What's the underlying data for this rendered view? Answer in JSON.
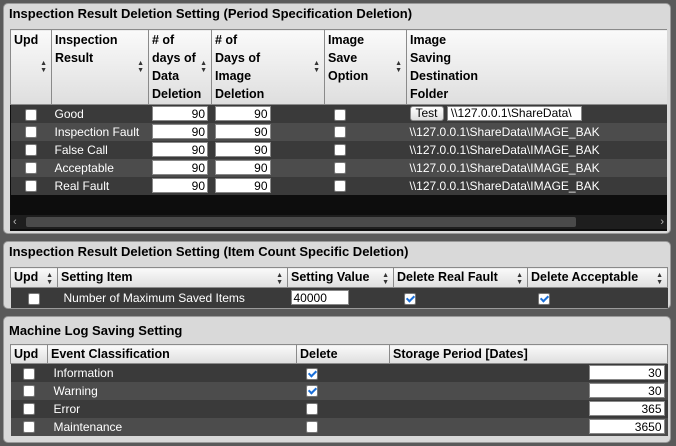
{
  "section1": {
    "title": "Inspection Result Deletion Setting (Period Specification Deletion)",
    "headers": [
      "Upd",
      "Inspection\nResult",
      "# of\ndays of\nData\nDeletion",
      "# of\nDays of\nImage\nDeletion",
      "Image\nSave\nOption",
      "Image\nSaving\nDestination\nFolder"
    ],
    "rows": [
      {
        "upd": false,
        "result": "Good",
        "data_days": "90",
        "image_days": "90",
        "save_option": false,
        "folder": "\\\\127.0.0.1\\ShareData\\",
        "test_label": "Test"
      },
      {
        "upd": false,
        "result": "Inspection Fault",
        "data_days": "90",
        "image_days": "90",
        "save_option": false,
        "folder": "\\\\127.0.0.1\\ShareData\\IMAGE_BAK"
      },
      {
        "upd": false,
        "result": "False Call",
        "data_days": "90",
        "image_days": "90",
        "save_option": false,
        "folder": "\\\\127.0.0.1\\ShareData\\IMAGE_BAK"
      },
      {
        "upd": false,
        "result": "Acceptable",
        "data_days": "90",
        "image_days": "90",
        "save_option": false,
        "folder": "\\\\127.0.0.1\\ShareData\\IMAGE_BAK"
      },
      {
        "upd": false,
        "result": "Real Fault",
        "data_days": "90",
        "image_days": "90",
        "save_option": false,
        "folder": "\\\\127.0.0.1\\ShareData\\IMAGE_BAK"
      }
    ]
  },
  "section2": {
    "title": "Inspection Result Deletion Setting (Item Count Specific Deletion)",
    "headers": [
      "Upd",
      "Setting Item",
      "Setting Value",
      "Delete Real Fault",
      "Delete Acceptable"
    ],
    "rows": [
      {
        "upd": false,
        "item": "Number of Maximum Saved Items",
        "value": "40000",
        "delete_real_fault": true,
        "delete_acceptable": true
      }
    ]
  },
  "section3": {
    "title": "Machine Log Saving Setting",
    "headers": [
      "Upd",
      "Event Classification",
      "Delete",
      "Storage Period [Dates]"
    ],
    "rows": [
      {
        "upd": false,
        "event": "Information",
        "delete": true,
        "period": "30"
      },
      {
        "upd": false,
        "event": "Warning",
        "delete": true,
        "period": "30"
      },
      {
        "upd": false,
        "event": "Error",
        "delete": false,
        "period": "365"
      },
      {
        "upd": false,
        "event": "Maintenance",
        "delete": false,
        "period": "3650"
      }
    ]
  }
}
